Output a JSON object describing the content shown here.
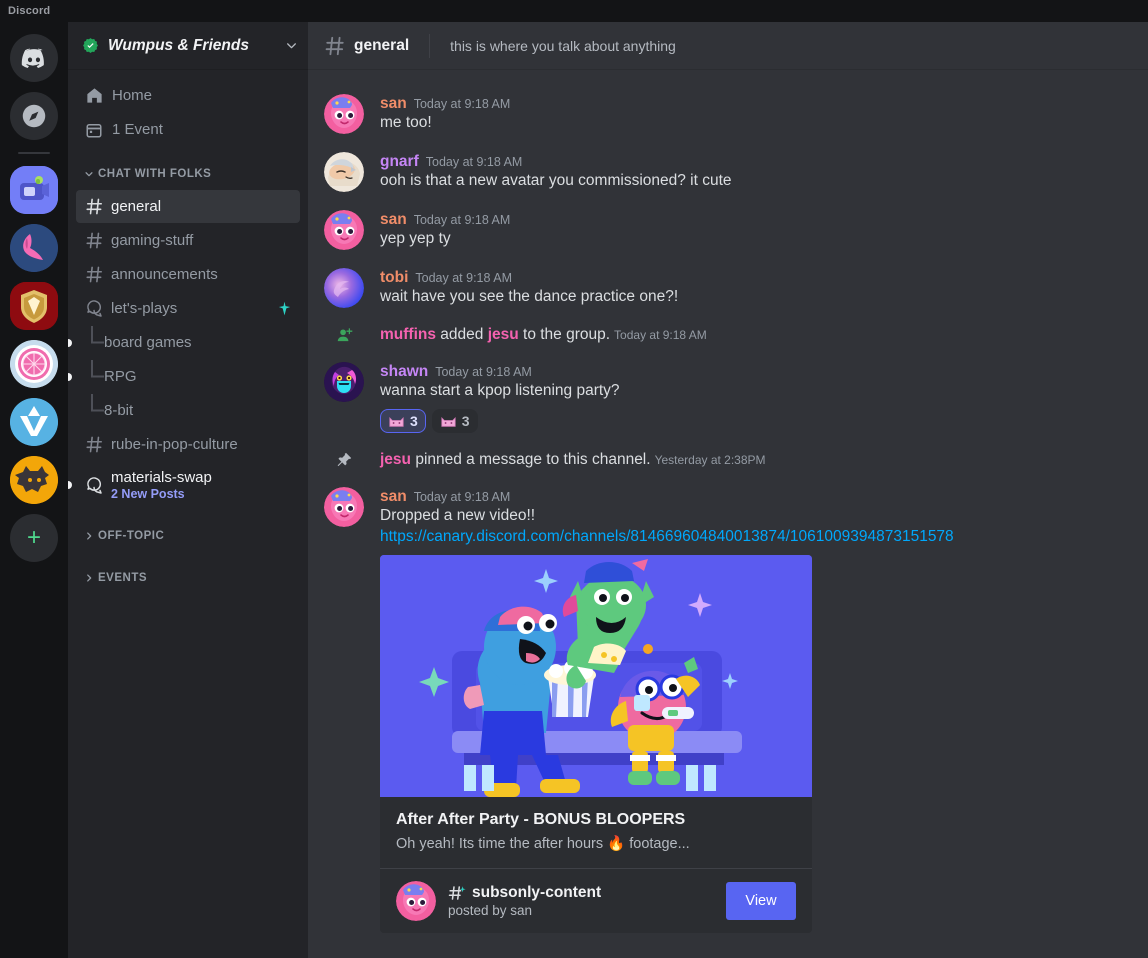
{
  "window": {
    "brand": "Discord"
  },
  "rail": {
    "items": [
      {
        "name": "discord-home",
        "label": "Discord Home"
      },
      {
        "name": "explore",
        "label": "Explore Public Servers"
      },
      {
        "name": "guild-wumpus",
        "label": "Wumpus & Friends"
      },
      {
        "name": "guild-bunny",
        "label": "Bunny Server"
      },
      {
        "name": "guild-crest",
        "label": "Crest Server"
      },
      {
        "name": "guild-disco",
        "label": "Disco Server"
      },
      {
        "name": "guild-vee",
        "label": "Vee Server"
      },
      {
        "name": "guild-wolf",
        "label": "Wolf Server"
      }
    ],
    "add_label": "+"
  },
  "sidebar": {
    "guild_name": "Wumpus & Friends",
    "verified": true,
    "chevron": "⌄",
    "nav": [
      {
        "label": "Home",
        "icon": "home-icon"
      },
      {
        "label": "1 Event",
        "icon": "calendar-icon"
      }
    ],
    "categories": [
      {
        "label": "CHAT WITH FOLKS",
        "expanded": true,
        "arrow": "⌄",
        "channels": [
          {
            "label": "general",
            "type": "text",
            "active": true
          },
          {
            "label": "gaming-stuff",
            "type": "text",
            "active": false
          },
          {
            "label": "announcements",
            "type": "text",
            "active": false
          },
          {
            "label": "let's-plays",
            "type": "forum",
            "active": false,
            "badge": "sparkle"
          },
          {
            "label": "board games",
            "type": "thread",
            "unread": true
          },
          {
            "label": "RPG",
            "type": "thread",
            "unread": true
          },
          {
            "label": "8-bit",
            "type": "thread",
            "unread": false
          },
          {
            "label": "rube-in-pop-culture",
            "type": "text",
            "active": false
          },
          {
            "label": "materials-swap",
            "type": "forum-unread",
            "sub": "2 New Posts",
            "unread": true
          }
        ]
      },
      {
        "label": "OFF-TOPIC",
        "expanded": false,
        "arrow": "›",
        "channels": []
      },
      {
        "label": "EVENTS",
        "expanded": false,
        "arrow": "›",
        "channels": []
      }
    ]
  },
  "header": {
    "channel": "general",
    "topic": "this is where you talk about anything"
  },
  "messages": [
    {
      "kind": "message",
      "author": "san",
      "author_color": "#f08d69",
      "timestamp": "Today at 9:18 AM",
      "text": "me too!",
      "avatar": "san"
    },
    {
      "kind": "message",
      "author": "gnarf",
      "author_color": "#c586f5",
      "timestamp": "Today at 9:18 AM",
      "text": "ooh is that a new avatar you commissioned? it cute",
      "avatar": "gnarf"
    },
    {
      "kind": "message",
      "author": "san",
      "author_color": "#f08d69",
      "timestamp": "Today at 9:18 AM",
      "text": "yep yep ty",
      "avatar": "san"
    },
    {
      "kind": "message",
      "author": "tobi",
      "author_color": "#f08d69",
      "timestamp": "Today at 9:18 AM",
      "text": "wait have you see the dance practice one?!",
      "avatar": "tobi"
    },
    {
      "kind": "system-add",
      "actor": "muffins",
      "actor_color": "#f562b0",
      "middle": " added ",
      "target": "jesu",
      "target_color": "#f562b0",
      "tail": " to the group.",
      "timestamp": "Today at 9:18 AM"
    },
    {
      "kind": "message",
      "author": "shawn",
      "author_color": "#c586f5",
      "timestamp": "Today at 9:18 AM",
      "text": "wanna start a kpop listening party?",
      "avatar": "shawn",
      "reactions": [
        {
          "emoji": "pink-cat-emoji",
          "count": "3",
          "me": true
        },
        {
          "emoji": "pink-cat-emoji",
          "count": "3",
          "me": false
        }
      ]
    },
    {
      "kind": "system-pin",
      "actor": "jesu",
      "actor_color": "#f562b0",
      "tail": " pinned a message to this channel.",
      "timestamp": "Yesterday at 2:38PM"
    },
    {
      "kind": "message-embed",
      "author": "san",
      "author_color": "#f08d69",
      "timestamp": "Today at 9:18 AM",
      "text": "Dropped a new video!! ",
      "link": "https://canary.discord.com/channels/814669604840013874/1061009394873151578",
      "avatar": "san",
      "embed": {
        "title": "After After Party - BONUS BLOOPERS",
        "description": "Oh yeah! Its time the after hours 🔥 footage...",
        "footer_channel": "subsonly-content",
        "footer_sub": "posted by san",
        "button": "View"
      }
    }
  ],
  "colors": {
    "accent": "#5865f2",
    "link": "#00a8fc",
    "sparkle": "#2ed3c6",
    "unread_blue": "#949cf7",
    "verified_green": "#23a55a",
    "app_bg": "#313338",
    "sidebar_bg": "#232428",
    "rail_bg": "#131416"
  }
}
